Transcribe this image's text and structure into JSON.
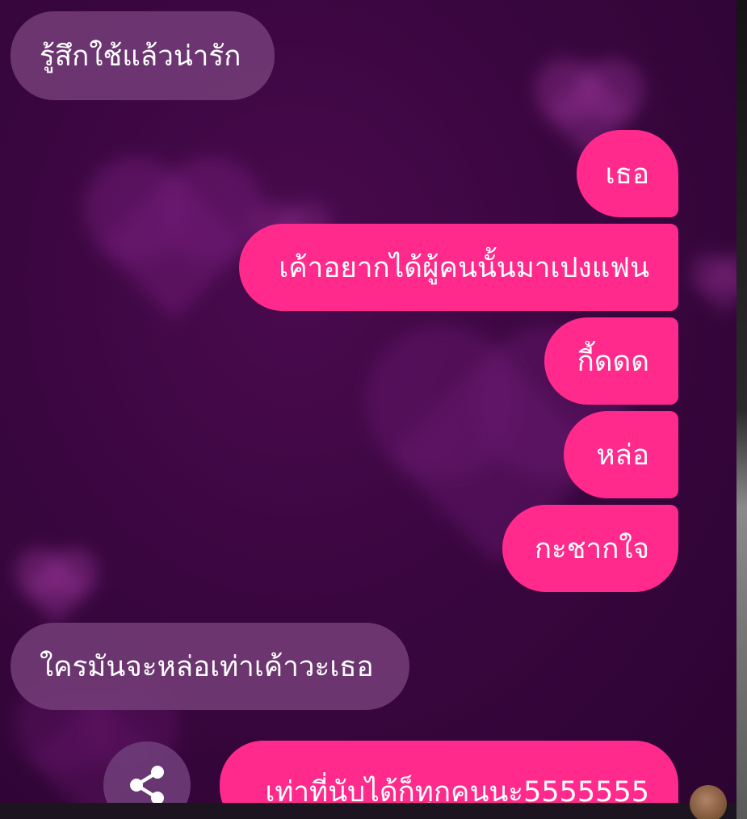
{
  "theme": {
    "background": "#3a0640",
    "incoming_bubble": "#733c78",
    "outgoing_bubble": "#ff2a8c",
    "text": "#ffffff"
  },
  "messages": [
    {
      "direction": "incoming",
      "text": "รู้สึกใช้แล้วน่ารัก"
    },
    {
      "direction": "outgoing",
      "text": "เธอ"
    },
    {
      "direction": "outgoing",
      "text": "เค้าอยากได้ผู้คนนั้นมาเปงแฟน"
    },
    {
      "direction": "outgoing",
      "text": "กี้ดดด"
    },
    {
      "direction": "outgoing",
      "text": "หล่อ"
    },
    {
      "direction": "outgoing",
      "text": "กะชากใจ"
    },
    {
      "direction": "incoming",
      "text": "ใครมันจะหล่อเท่าเค้าวะเธอ"
    },
    {
      "direction": "outgoing",
      "text": "เท่าที่นับได้ก็ทุกคนนะ5555555"
    }
  ],
  "actions": {
    "share_icon": "share-icon"
  }
}
